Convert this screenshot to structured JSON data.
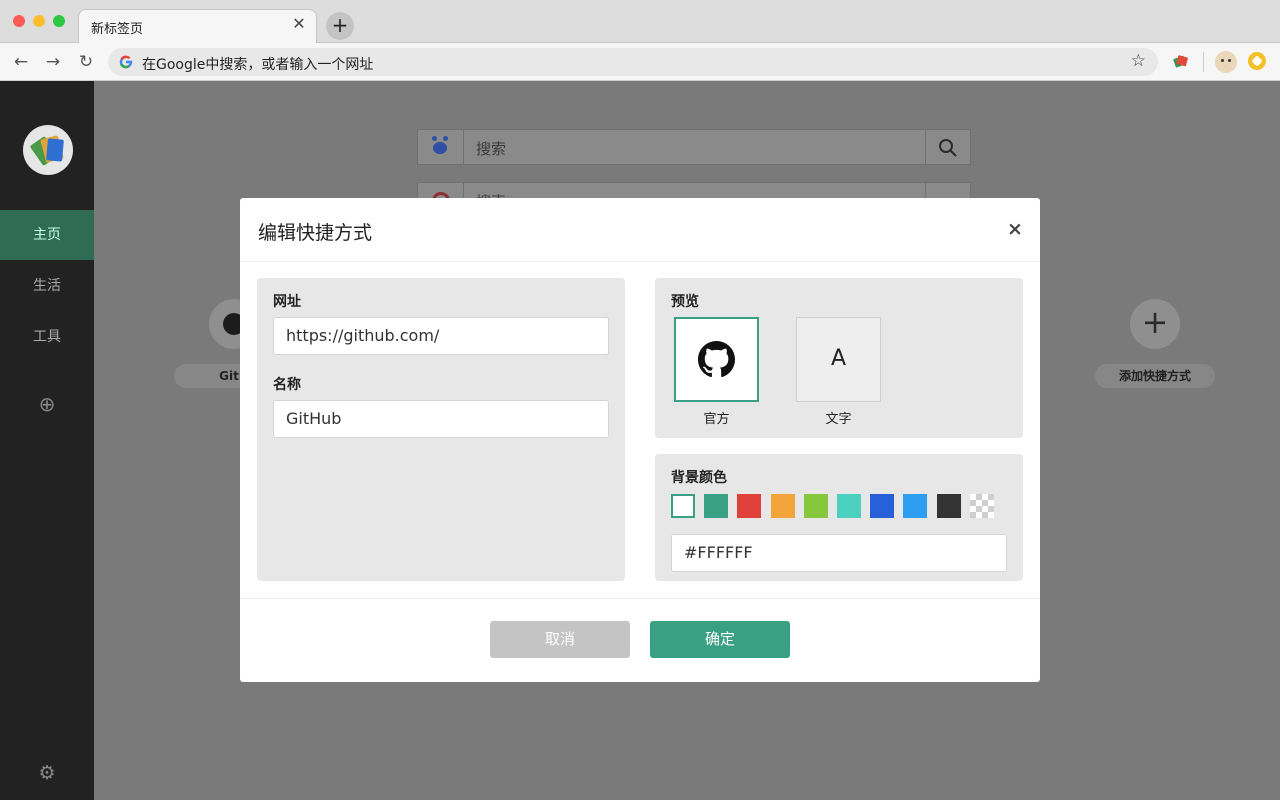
{
  "browser": {
    "tab_title": "新标签页",
    "tab_close": "✕",
    "new_tab": "+",
    "back": "←",
    "forward": "→",
    "reload": "↻",
    "omnibox_placeholder": "在Google中搜索，或者输入一个网址",
    "star": "☆"
  },
  "sidebar": {
    "items": [
      {
        "label": "主页",
        "active": true
      },
      {
        "label": "生活",
        "active": false
      },
      {
        "label": "工具",
        "active": false
      }
    ],
    "add": "⊕",
    "settings": "⚙"
  },
  "main": {
    "search_placeholder_1": "搜索",
    "search_placeholder_2": "搜索",
    "shortcut_left_label": "GitH",
    "add_shortcut_label": "添加快捷方式",
    "add_shortcut_icon": "+"
  },
  "modal": {
    "title": "编辑快捷方式",
    "close": "×",
    "url_label": "网址",
    "url_value": "https://github.com/",
    "name_label": "名称",
    "name_value": "GitHub",
    "preview_label": "预览",
    "preview_official_caption": "官方",
    "preview_text_caption": "文字",
    "preview_text_letter": "A",
    "bg_color_label": "背景颜色",
    "swatches": [
      "#FFFFFF",
      "#3aa083",
      "#e0413a",
      "#f3a43b",
      "#87c73b",
      "#4cd0c0",
      "#2760d8",
      "#2e9ef2",
      "#333333",
      "transparent"
    ],
    "color_value": "#FFFFFF",
    "cancel_label": "取消",
    "confirm_label": "确定"
  }
}
